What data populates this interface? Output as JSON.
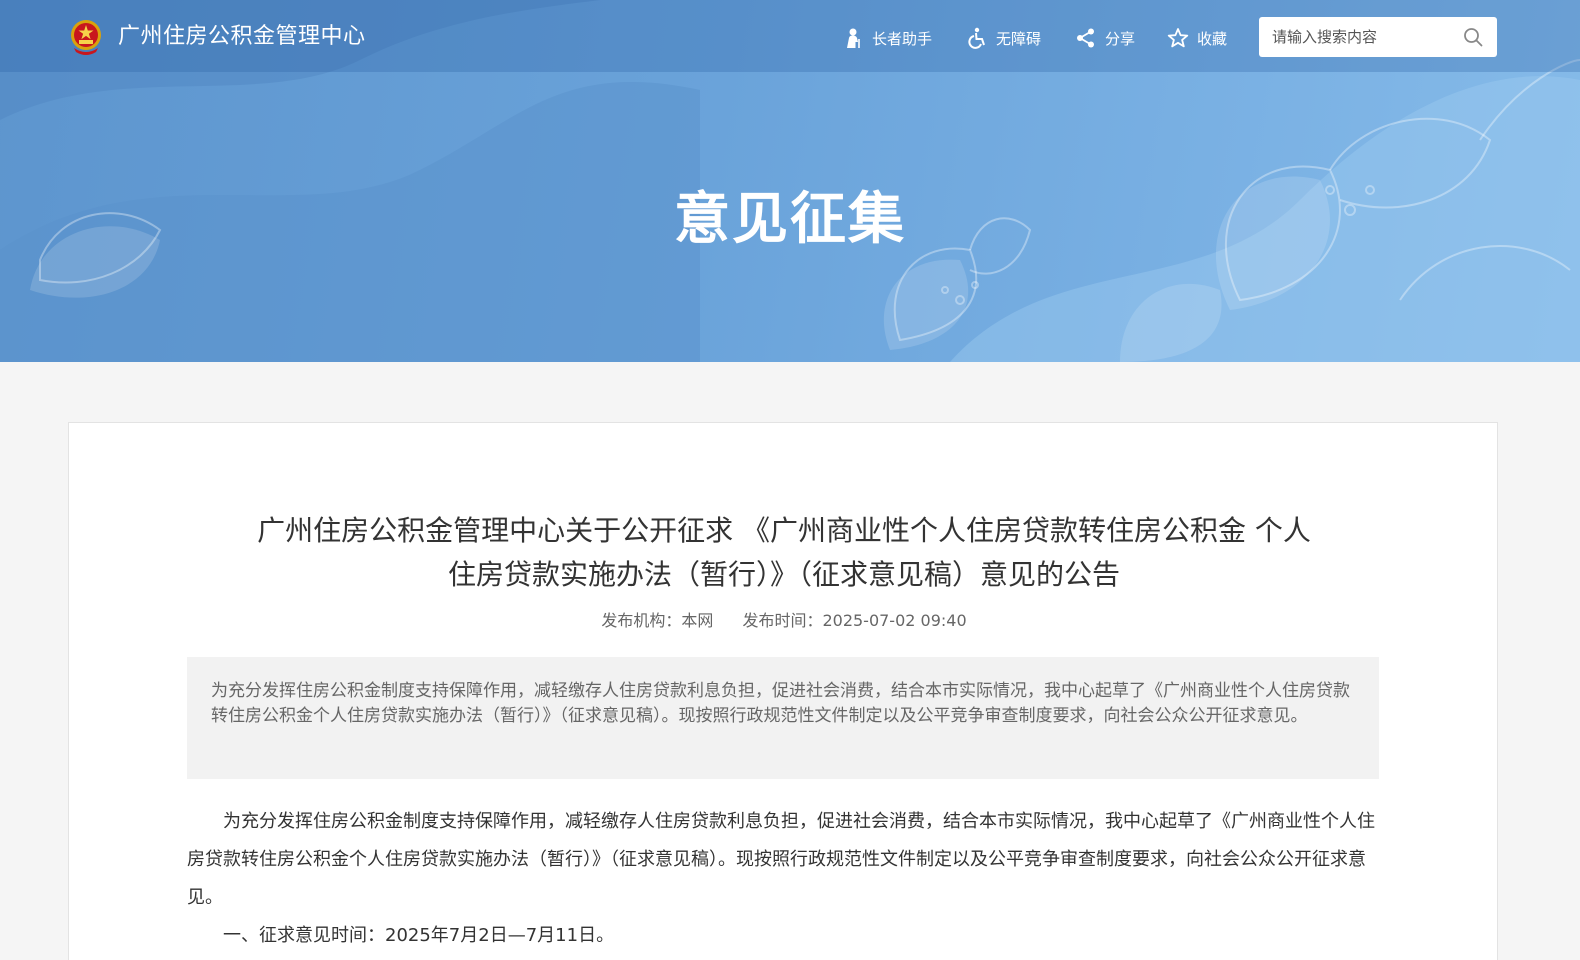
{
  "header": {
    "site_name": "广州住房公积金管理中心",
    "tools": {
      "elder": "长者助手",
      "accessibility": "无障碍",
      "share": "分享",
      "favorite": "收藏"
    },
    "search": {
      "placeholder": "请输入搜索内容",
      "value": ""
    }
  },
  "banner": {
    "title": "意见征集"
  },
  "article": {
    "title": "广州住房公积金管理中心关于公开征求 《广州商业性个人住房贷款转住房公积金 个人住房贷款实施办法（暂行）》（征求意见稿）意见的公告",
    "publisher_label": "发布机构：本网",
    "time_label": "发布时间：2025-07-02 09:40",
    "summary": "为充分发挥住房公积金制度支持保障作用，减轻缴存人住房贷款利息负担，促进社会消费，结合本市实际情况，我中心起草了《广州商业性个人住房贷款转住房公积金个人住房贷款实施办法（暂行）》（征求意见稿）。现按照行政规范性文件制定以及公平竞争审查制度要求，向社会公众公开征求意见。",
    "paragraphs": [
      "为充分发挥住房公积金制度支持保障作用，减轻缴存人住房贷款利息负担，促进社会消费，结合本市实际情况，我中心起草了《广州商业性个人住房贷款转住房公积金个人住房贷款实施办法（暂行）》（征求意见稿）。现按照行政规范性文件制定以及公平竞争审查制度要求，向社会公众公开征求意见。",
      "一、征求意见时间：2025年7月2日—7月11日。"
    ]
  },
  "colors": {
    "banner_blue": "#6aa3da",
    "page_bg": "#f5f5f5",
    "summary_bg": "#f2f2f2"
  }
}
